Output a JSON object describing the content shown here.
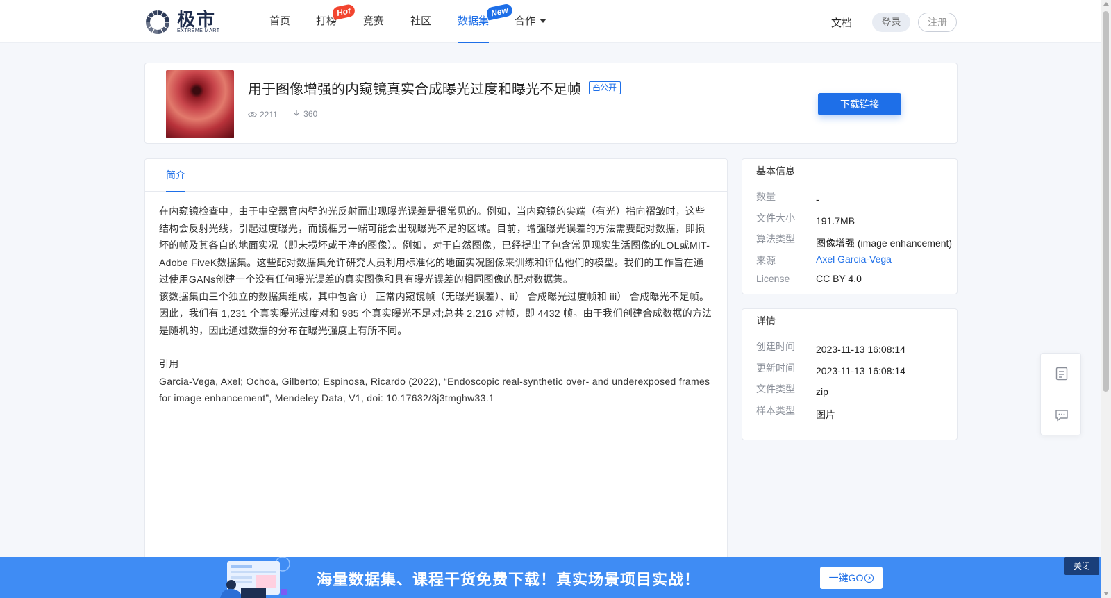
{
  "header": {
    "logo_cn": "极市",
    "logo_en": "EXTREME MART",
    "nav": [
      {
        "label": "首页"
      },
      {
        "label": "打榜",
        "badge": "Hot"
      },
      {
        "label": "竞赛"
      },
      {
        "label": "社区"
      },
      {
        "label": "数据集",
        "badge": "New",
        "active": true
      },
      {
        "label": "合作"
      }
    ],
    "docs": "文档",
    "login": "登录",
    "register": "注册"
  },
  "dataset": {
    "title": "用于图像增强的内窥镜真实合成曝光过度和曝光不足帧",
    "visibility": "公开",
    "views": "2211",
    "downloads": "360",
    "download_button": "下载链接"
  },
  "intro": {
    "tab": "简介",
    "paragraphs": [
      "在内窥镜检查中，由于中空器官内壁的光反射而出现曝光误差是很常见的。例如，当内窥镜的尖端（有光）指向褶皱时，这些结构会反射光线，引起过度曝光，而镜框另一端可能会出现曝光不足的区域。目前，增强曝光误差的方法需要配对数据，即损坏的帧及其各自的地面实况（即未损坏或干净的图像）。例如，对于自然图像，已经提出了包含常见现实生活图像的LOL或MIT-Adobe FiveK数据集。这些配对数据集允许研究人员利用标准化的地面实况图像来训练和评估他们的模型。我们的工作旨在通过使用GANs创建一个没有任何曝光误差的真实图像和具有曝光误差的相同图像的配对数据集。",
      "该数据集由三个独立的数据集组成，其中包含 i） 正常内窥镜帧（无曝光误差）、ii） 合成曝光过度帧和 iii） 合成曝光不足帧。因此，我们有 1,231 个真实曝光过度对和 985 个真实曝光不足对;总共 2,216 对帧，即 4432 帧。由于我们创建合成数据的方法是随机的，因此通过数据的分布在曝光强度上有所不同。"
    ],
    "citation_heading": "引用",
    "citation": "Garcia-Vega, Axel; Ochoa, Gilberto; Espinosa, Ricardo (2022), “Endoscopic real-synthetic over- and underexposed frames for image enhancement”, Mendeley Data, V1, doi: 10.17632/3j3tmghw33.1"
  },
  "basic_info": {
    "title": "基本信息",
    "rows": [
      {
        "key": "数量",
        "value": "-"
      },
      {
        "key": "文件大小",
        "value": "191.7MB"
      },
      {
        "key": "算法类型",
        "value": "图像增强 (image enhancement)"
      },
      {
        "key": "来源",
        "value": "Axel Garcia-Vega",
        "link": true
      },
      {
        "key": "License",
        "value": "CC BY 4.0"
      }
    ]
  },
  "details": {
    "title": "详情",
    "rows": [
      {
        "key": "创建时间",
        "value": "2023-11-13 16:08:14"
      },
      {
        "key": "更新时间",
        "value": "2023-11-13 16:08:14"
      },
      {
        "key": "文件类型",
        "value": "zip"
      },
      {
        "key": "样本类型",
        "value": "图片"
      }
    ]
  },
  "promo": {
    "text": "海量数据集、课程干货免费下载！真实场景项目实战！",
    "button": "一键GO",
    "close": "关闭"
  },
  "colors": {
    "accent": "#1e6fe8",
    "hot_badge": "#f2452f",
    "promo_bg": "#3f8cf4"
  }
}
